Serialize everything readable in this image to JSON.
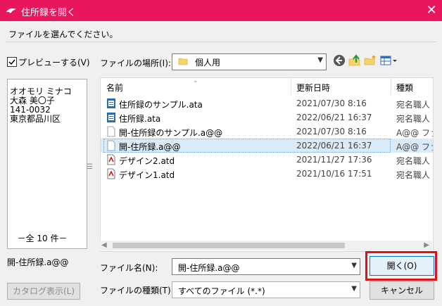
{
  "window": {
    "title": "住所録を開く",
    "close": "✕",
    "accent_color": "#e8175d"
  },
  "instruction": "ファイルを選んでください。",
  "preview": {
    "label": "プレビューする(V)",
    "checked": true,
    "lines": [
      "オオモリ ミナコ",
      "大森 美〇子",
      "141-0032",
      "東京都品川区"
    ],
    "count": "－全 10 件－",
    "filename": "開-住所録.a@@"
  },
  "catalog_button": "カタログ表示(L)",
  "location": {
    "label": "ファイルの場所(I):",
    "value": "個人用"
  },
  "columns": {
    "name": "名前",
    "date": "更新日時",
    "type": "種類"
  },
  "files": [
    {
      "name": "住所録のサンプル.ata",
      "date": "2021/07/30 8:16",
      "type": "宛名職人",
      "icon": "address-book-icon"
    },
    {
      "name": "住所録.ata",
      "date": "2022/06/21 16:37",
      "type": "宛名職人",
      "icon": "address-book-icon"
    },
    {
      "name": "開-住所録のサンプル.a@@",
      "date": "2021/07/30 8:16",
      "type": "A@@ ファ",
      "icon": "blank-file-icon"
    },
    {
      "name": "開-住所録.a@@",
      "date": "2022/06/21 16:37",
      "type": "A@@ ファ",
      "icon": "blank-file-icon"
    },
    {
      "name": "デザイン2.atd",
      "date": "2021/11/27 17:36",
      "type": "宛名職人",
      "icon": "design-file-icon"
    },
    {
      "name": "デザイン1.atd",
      "date": "2021/10/16 17:51",
      "type": "宛名職人",
      "icon": "design-file-icon"
    }
  ],
  "selected_file_index": 3,
  "filename_field": {
    "label": "ファイル名(N):",
    "value": "開-住所録.a@@"
  },
  "filetype_field": {
    "label": "ファイルの種類(T):",
    "value": "すべてのファイル (*.*)"
  },
  "buttons": {
    "open": "開く(O)",
    "cancel": "キャンセル"
  },
  "highlight_color": "#e0101a"
}
